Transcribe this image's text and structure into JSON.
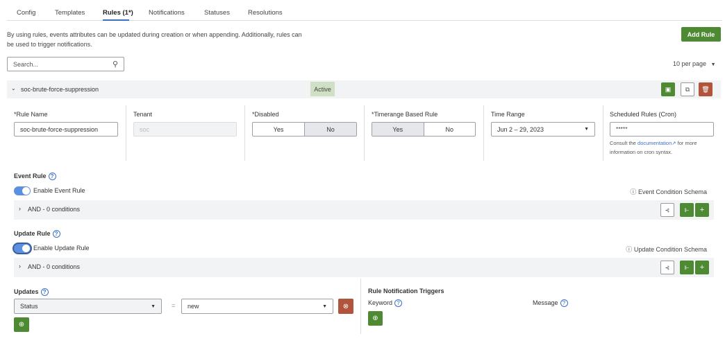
{
  "tabs": [
    {
      "label": "Config"
    },
    {
      "label": "Templates"
    },
    {
      "label": "Rules (1*)"
    },
    {
      "label": "Notifications"
    },
    {
      "label": "Statuses"
    },
    {
      "label": "Resolutions"
    }
  ],
  "description_line1": "By using rules, events attributes can be updated during creation or when appending. Additionally, rules can",
  "description_line2": "be used to trigger notifications.",
  "add_rule_label": "Add Rule",
  "search": {
    "placeholder": "Search..."
  },
  "per_page": "10 per page",
  "rule": {
    "name": "soc-brute-force-suppression",
    "status": "Active",
    "fields": {
      "rule_name_label": "Rule Name",
      "rule_name_value": "soc-brute-force-suppression",
      "tenant_label": "Tenant",
      "tenant_value": "soc",
      "disabled_label": "Disabled",
      "disabled_yes": "Yes",
      "disabled_no": "No",
      "disabled_selected": "No",
      "timerange_label": "Timerange Based Rule",
      "timerange_yes": "Yes",
      "timerange_no": "No",
      "timerange_selected": "Yes",
      "time_range_label": "Time Range",
      "time_range_value": "Jun 2 – 29, 2023",
      "cron_label": "Scheduled Rules (Cron)",
      "cron_value": "* * * * *",
      "cron_help_pre": "Consult the",
      "cron_help_link": "documentation",
      "cron_help_post": "for more",
      "cron_help_line2": "information on cron syntax."
    },
    "event_rule": {
      "title": "Event Rule",
      "toggle_label": "Enable Event Rule",
      "enabled": true,
      "schema_link": "Event Condition Schema",
      "conditions": "AND - 0 conditions"
    },
    "update_rule": {
      "title": "Update Rule",
      "toggle_label": "Enable Update Rule",
      "enabled": true,
      "schema_link": "Update Condition Schema",
      "conditions": "AND - 0 conditions"
    },
    "updates": {
      "title": "Updates",
      "field": "Status",
      "operator": "=",
      "value": "new"
    },
    "notifications": {
      "title": "Rule Notification Triggers",
      "keyword_label": "Keyword",
      "message_label": "Message"
    }
  }
}
